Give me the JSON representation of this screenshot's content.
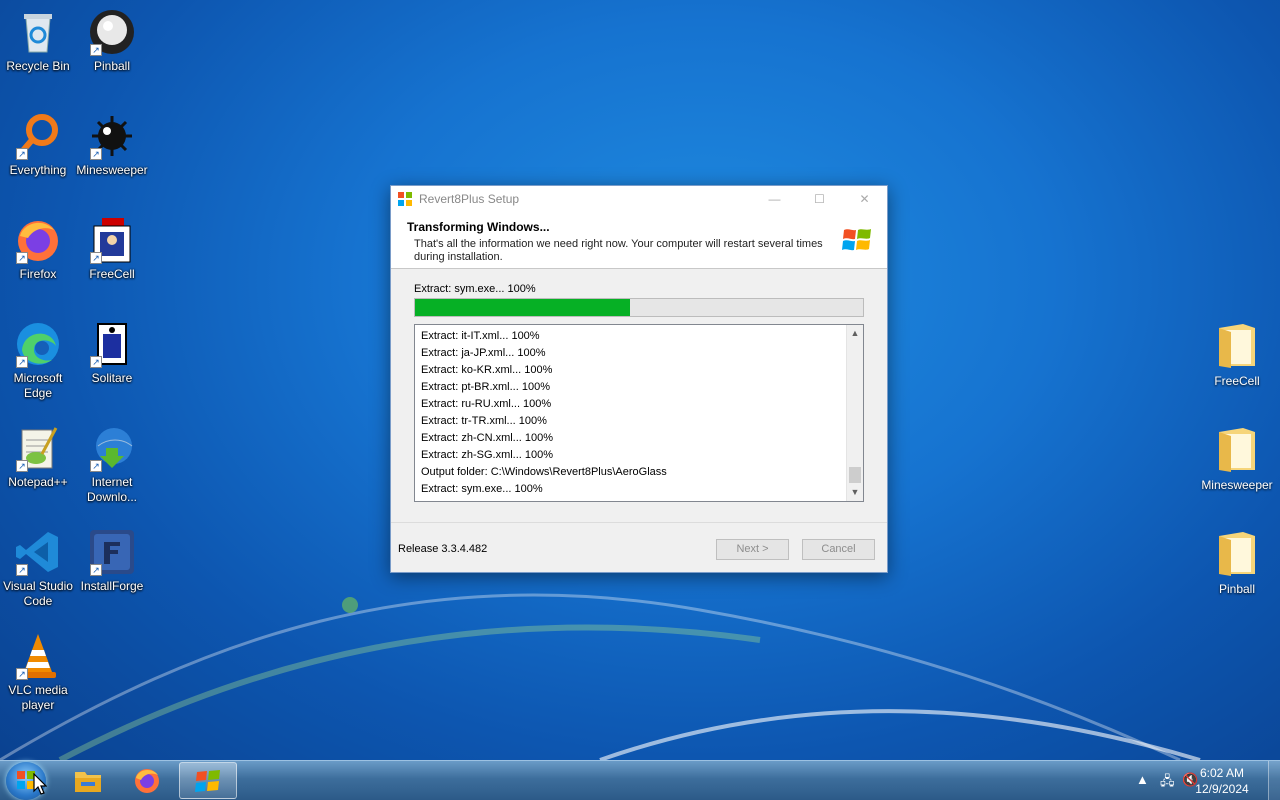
{
  "desktop_left": [
    {
      "id": "recycle-bin",
      "label": "Recycle Bin"
    },
    {
      "id": "pinball",
      "label": "Pinball"
    },
    {
      "id": "everything",
      "label": "Everything"
    },
    {
      "id": "minesweeper",
      "label": "Minesweeper"
    },
    {
      "id": "firefox",
      "label": "Firefox"
    },
    {
      "id": "freecell",
      "label": "FreeCell"
    },
    {
      "id": "edge",
      "label": "Microsoft Edge"
    },
    {
      "id": "solitaire",
      "label": "Solitare"
    },
    {
      "id": "notepadpp",
      "label": "Notepad++"
    },
    {
      "id": "idm",
      "label": "Internet Downlo..."
    },
    {
      "id": "vscode",
      "label": "Visual Studio Code"
    },
    {
      "id": "installforge",
      "label": "InstallForge"
    },
    {
      "id": "vlc",
      "label": "VLC media player"
    }
  ],
  "desktop_right": [
    {
      "label": "FreeCell"
    },
    {
      "label": "Minesweeper"
    },
    {
      "label": "Pinball"
    }
  ],
  "dialog": {
    "title": "Revert8Plus Setup",
    "controls": {
      "minimize": "—",
      "maximize": "☐",
      "close": "✕"
    },
    "header_title": "Transforming Windows...",
    "header_subtitle": "That's all the information we need right now. Your computer will restart several times during installation.",
    "status": "Extract: sym.exe... 100%",
    "progress": 0.48,
    "log": [
      "Extract: it-IT.xml... 100%",
      "Extract: ja-JP.xml... 100%",
      "Extract: ko-KR.xml... 100%",
      "Extract: pt-BR.xml... 100%",
      "Extract: ru-RU.xml... 100%",
      "Extract: tr-TR.xml... 100%",
      "Extract: zh-CN.xml... 100%",
      "Extract: zh-SG.xml... 100%",
      "Output folder: C:\\Windows\\Revert8Plus\\AeroGlass",
      "Extract: sym.exe... 100%"
    ],
    "release": "Release 3.3.4.482",
    "next_label": "Next >",
    "cancel_label": "Cancel"
  },
  "taskbar": {
    "time": "6:02 AM",
    "date": "12/9/2024"
  },
  "colors": {
    "progress": "#06b025"
  }
}
